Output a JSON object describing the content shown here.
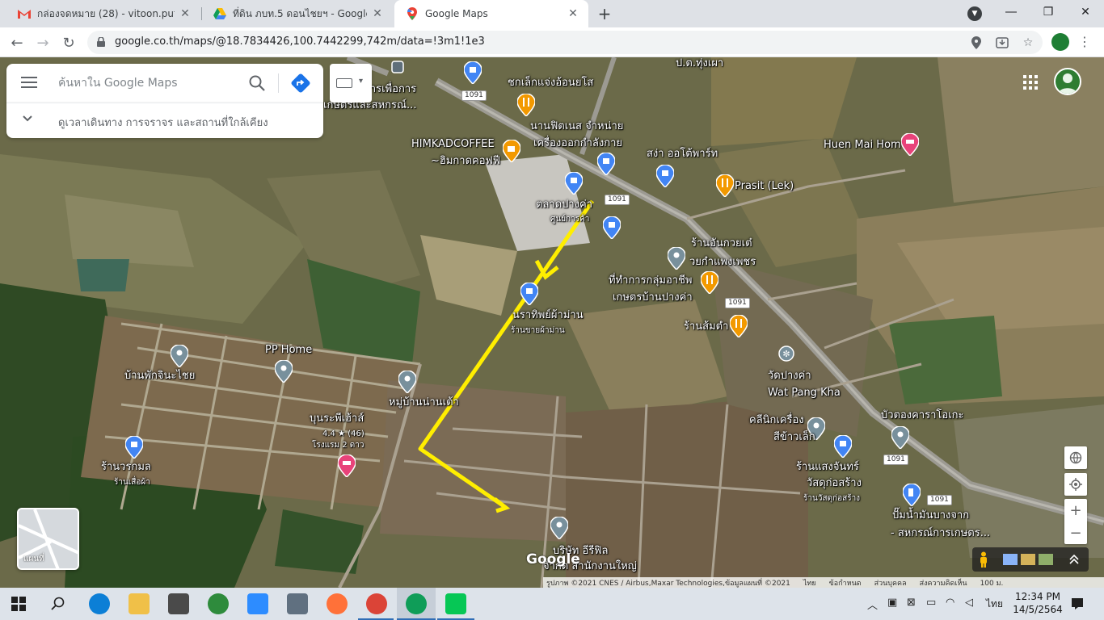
{
  "browser": {
    "tabs": [
      {
        "title": "กล่องจดหมาย (28) - vitoon.putthak",
        "icon": "gmail-icon",
        "active": false
      },
      {
        "title": "ที่ดิน ภบท.5 ดอนไชยฯ - Google ไดรฟ์",
        "icon": "drive-icon",
        "active": false
      },
      {
        "title": "Google Maps",
        "icon": "maps-icon",
        "active": true
      }
    ],
    "new_tab": "+",
    "url": "google.co.th/maps/@18.7834426,100.7442299,742m/data=!3m1!1e3"
  },
  "search": {
    "placeholder": "ค้นหาใน Google Maps",
    "sub_text": "ดูเวลาเดินทาง การจราจร และสถานที่ใกล้เคียง"
  },
  "map": {
    "labels": {
      "l1": "ป.ต.ทุ่งเผา",
      "l2": "ชกเล็กแจ่งอ้อนยโส",
      "l3": "การเพื่อการ",
      "l4": "เกษตรและสหกรณ์...",
      "l5": "นานฟิตเนส จำหน่าย",
      "l6": "เครื่องออกกำลังกาย",
      "l7": "HIMKADCOFFEE",
      "l8": "~ฮิมกาดคอฟฟี",
      "l9": "สง่า ออโต้พาร์ท",
      "l10": "Huen Mai Hom",
      "l11": "Prasit (Lek)",
      "l12": "ตลาดปางค่า",
      "l13": "ศูนย์การค้า",
      "l14": "ร้านอันกวยเต๋",
      "l15": "วยกำแพงเพชร",
      "l16": "ที่ทำการกลุ่มอาชีพ",
      "l17": "เกษตรบ้านปางค่า",
      "l18": "นราทิพย์ผ้าม่าน",
      "l19": "ร้านขายผ้าม่าน",
      "l20": "ร้านส้มตำ",
      "l21": "PP Home",
      "l22": "บ้านพักจินะไชย",
      "l23": "หมู่บ้านน่านเต้า",
      "l24": "วัดปางค่า",
      "l25": "Wat Pang Kha",
      "l26": "คลีนิกเครื่อง",
      "l27": "สีข้าวเล็ก",
      "l28": "บัวตองคาราโอเกะ",
      "l29": "บุนระพีเฮ้าส์",
      "l30": "4.4 ★ (46)",
      "l31": "โรงแรม 2 ดาว",
      "l32": "ร้านวรกมล",
      "l33": "ร้านเสื่อผ้า",
      "l34": "ร้านแสงจันทร์",
      "l35": "วัสดุก่อสร้าง",
      "l36": "ร้านวัสดุก่อสร้าง",
      "l37": "ปั๊มน้ำมันบางจาก",
      "l38": "- สหกรณ์การเกษตร...",
      "l39": "บริษัท อีรีฟิล",
      "l40": "จำกัด สำนักงานใหญ่"
    },
    "route_shield": "1091",
    "minimap_label": "แผนที่",
    "google_logo": "Google",
    "attribution": "รูปภาพ ©2021 CNES / Airbus,Maxar Technologies,ข้อมูลแผนที่ ©2021",
    "footer_links": [
      "ไทย",
      "ข้อกำหนด",
      "ส่วนบุคคล",
      "ส่งความคิดเห็น"
    ],
    "scale": "100 ม."
  },
  "taskbar": {
    "tray_lang": "ไทย",
    "time": "12:34 PM",
    "date": "14/5/2564"
  },
  "colors": {
    "route": "#ffee00",
    "accent": "#1a73e8"
  }
}
